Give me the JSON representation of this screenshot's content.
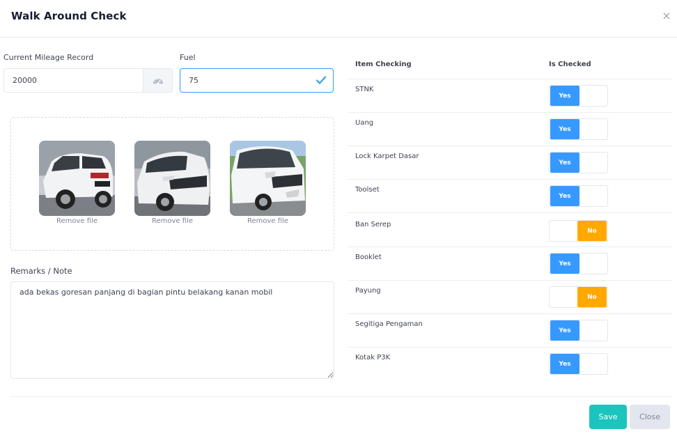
{
  "modal": {
    "title": "Walk Around Check",
    "close_glyph": "×"
  },
  "form": {
    "mileage_label": "Current Mileage Record",
    "mileage_value": "20000",
    "mileage_addon_icon": "speedometer-icon",
    "fuel_label": "Fuel",
    "fuel_value": "75",
    "fuel_valid_icon": "check-icon",
    "remarks_label": "Remarks / Note",
    "remarks_value": "ada bekas goresan panjang di bagian pintu belakang kanan mobil"
  },
  "photos": [
    {
      "remove_label": "Remove file"
    },
    {
      "remove_label": "Remove file"
    },
    {
      "remove_label": "Remove file"
    }
  ],
  "checklist": {
    "col_item": "Item Checking",
    "col_checked": "Is Checked",
    "items": [
      {
        "label": "STNK",
        "state": "Yes"
      },
      {
        "label": "Uang",
        "state": "Yes"
      },
      {
        "label": "Lock Karpet Dasar",
        "state": "Yes"
      },
      {
        "label": "Toolset",
        "state": "Yes"
      },
      {
        "label": "Ban Serep",
        "state": "No"
      },
      {
        "label": "Booklet",
        "state": "Yes"
      },
      {
        "label": "Payung",
        "state": "No"
      },
      {
        "label": "Segitiga Pengaman",
        "state": "Yes"
      },
      {
        "label": "Kotak P3K",
        "state": "Yes"
      }
    ]
  },
  "footer": {
    "save_label": "Save",
    "close_label": "Close"
  },
  "colors": {
    "primary": "#3699ff",
    "warning": "#ffa800",
    "success": "#1bc5bd",
    "light": "#e4e6ef"
  }
}
